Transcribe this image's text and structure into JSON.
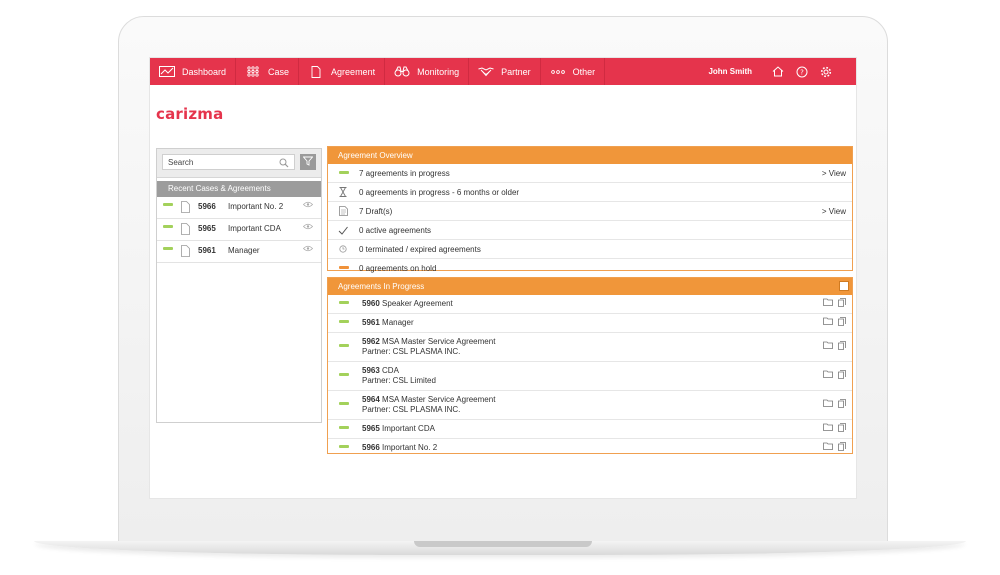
{
  "nav": {
    "items": [
      {
        "label": "Dashboard",
        "icon": "chart-area-icon"
      },
      {
        "label": "Case",
        "icon": "grid-dots-icon"
      },
      {
        "label": "Agreement",
        "icon": "document-icon"
      },
      {
        "label": "Monitoring",
        "icon": "binoculars-icon"
      },
      {
        "label": "Partner",
        "icon": "handshake-icon"
      },
      {
        "label": "Other",
        "icon": "more-dots-icon"
      }
    ],
    "user_name": "John Smith"
  },
  "logo": "carizma",
  "search": {
    "placeholder": "Search"
  },
  "recent": {
    "header": "Recent Cases & Agreements",
    "items": [
      {
        "num": "5966",
        "title": "Important No. 2"
      },
      {
        "num": "5965",
        "title": "Important CDA"
      },
      {
        "num": "5961",
        "title": "Manager"
      }
    ]
  },
  "overview": {
    "header": "Agreement Overview",
    "rows": [
      {
        "text": "7  agreements in progress",
        "view": "> View",
        "icon": "green-dash"
      },
      {
        "text": "0  agreements in progress - 6 months or older",
        "view": "",
        "icon": "hourglass-icon"
      },
      {
        "text": "7  Draft(s)",
        "view": "> View",
        "icon": "draft-doc-icon"
      },
      {
        "text": "0  active agreements",
        "view": "",
        "icon": "checkmark-icon"
      },
      {
        "text": "0  terminated / expired agreements",
        "view": "",
        "icon": "clock-icon"
      },
      {
        "text": "0  agreements on hold",
        "view": "",
        "icon": "orange-dash"
      }
    ]
  },
  "in_progress": {
    "header": "Agreements In Progress",
    "rows": [
      {
        "num": "5960",
        "title": "Speaker Agreement",
        "partner": ""
      },
      {
        "num": "5961",
        "title": "Manager",
        "partner": ""
      },
      {
        "num": "5962",
        "title": "MSA Master Service Agreement",
        "partner": "Partner: CSL PLASMA INC."
      },
      {
        "num": "5963",
        "title": "CDA",
        "partner": "Partner: CSL Limited"
      },
      {
        "num": "5964",
        "title": "MSA Master Service Agreement",
        "partner": "Partner: CSL PLASMA INC."
      },
      {
        "num": "5965",
        "title": "Important CDA",
        "partner": ""
      },
      {
        "num": "5966",
        "title": "Important No. 2",
        "partner": ""
      }
    ]
  },
  "colors": {
    "brand_red": "#e5344c",
    "panel_orange": "#f0963a",
    "status_green": "#a3d15b",
    "status_orange": "#f0923a"
  }
}
